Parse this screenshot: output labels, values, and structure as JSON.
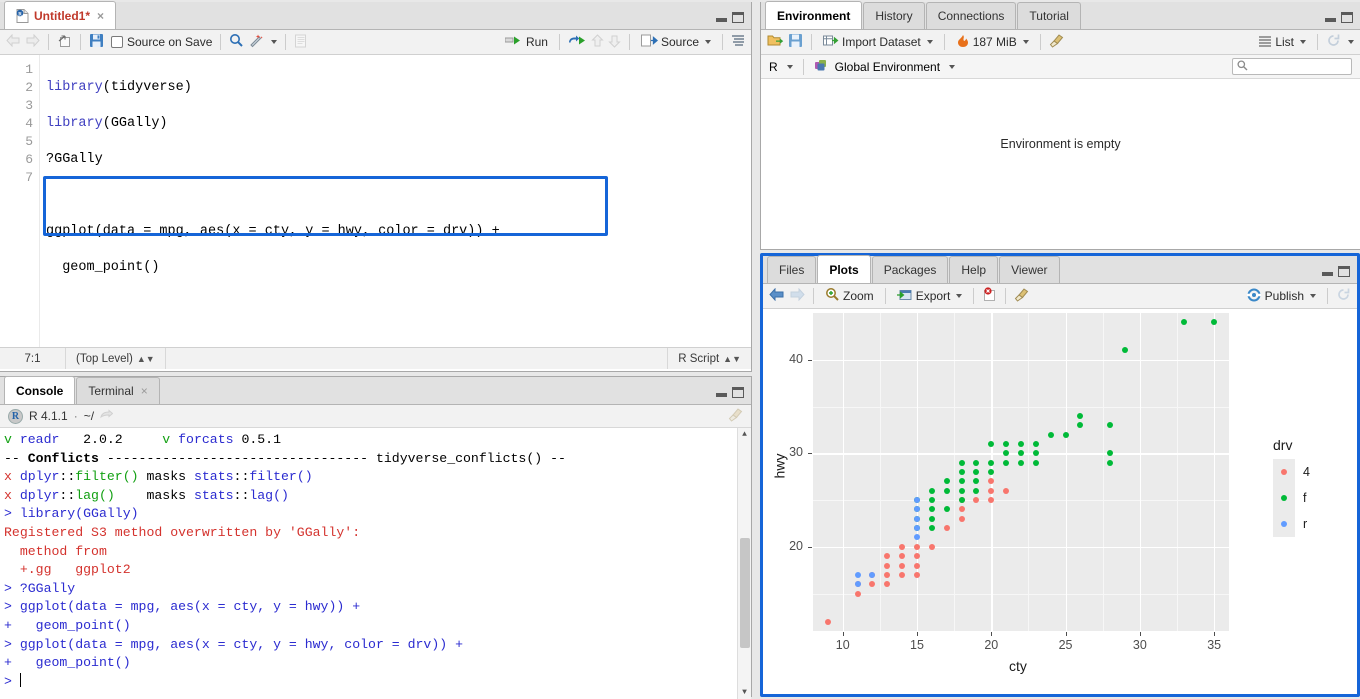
{
  "source": {
    "tab": {
      "label": "Untitled1*",
      "icon": "r-document-icon",
      "close": "×"
    },
    "toolbar": {
      "back": "back-arrow",
      "forward": "forward-arrow",
      "popout": "show-in-new-window",
      "save": "save-icon",
      "source_on_save_label": "Source on Save",
      "find": "magnifier-icon",
      "wand": "code-tools-icon",
      "outline_left": "compile-report-icon",
      "run_label": "Run",
      "rerun": "re-run-icon",
      "prev_chunk": "up-arrow",
      "next_chunk": "down-arrow",
      "source_label": "Source",
      "outline_label": "document-outline-icon"
    },
    "line_numbers": [
      "1",
      "2",
      "3",
      "4",
      "5",
      "6",
      "7"
    ],
    "code_lines": [
      {
        "kw": "library",
        "rest": "(tidyverse)"
      },
      {
        "kw": "library",
        "rest": "(GGally)"
      },
      {
        "kw": "",
        "rest": "?GGally"
      },
      {
        "kw": "",
        "rest": ""
      },
      {
        "kw": "",
        "rest": "ggplot(data = mpg, aes(x = cty, y = hwy, color = drv)) +"
      },
      {
        "kw": "",
        "rest": "  geom_point()"
      },
      {
        "kw": "",
        "rest": ""
      }
    ],
    "status": {
      "position": "7:1",
      "scope": "(Top Level)",
      "filetype": "R Script"
    }
  },
  "console": {
    "tabs": [
      {
        "label": "Console",
        "active": true,
        "closable": false
      },
      {
        "label": "Terminal",
        "active": false,
        "closable": true
      }
    ],
    "header": {
      "r_version": "R 4.1.1",
      "separator": "·",
      "path": "~/",
      "broom": "clear-console-icon"
    },
    "lines": [
      [
        {
          "t": "v ",
          "c": "green"
        },
        {
          "t": "readr   ",
          "c": "blue"
        },
        {
          "t": "2.0.2",
          "c": "black"
        },
        {
          "t": "     ",
          "c": "black"
        },
        {
          "t": "v ",
          "c": "green"
        },
        {
          "t": "forcats ",
          "c": "blue"
        },
        {
          "t": "0.5.1",
          "c": "black"
        }
      ],
      [
        {
          "t": "-- ",
          "c": "black"
        },
        {
          "t": "Conflicts",
          "c": "black",
          "b": true
        },
        {
          "t": " --------------------------------- tidyverse_conflicts() --",
          "c": "black"
        }
      ],
      [
        {
          "t": "x ",
          "c": "red"
        },
        {
          "t": "dplyr",
          "c": "blue"
        },
        {
          "t": "::",
          "c": "black"
        },
        {
          "t": "filter()",
          "c": "green"
        },
        {
          "t": " masks ",
          "c": "black"
        },
        {
          "t": "stats",
          "c": "blue"
        },
        {
          "t": "::",
          "c": "black"
        },
        {
          "t": "filter()",
          "c": "blue"
        }
      ],
      [
        {
          "t": "x ",
          "c": "red"
        },
        {
          "t": "dplyr",
          "c": "blue"
        },
        {
          "t": "::",
          "c": "black"
        },
        {
          "t": "lag()",
          "c": "green"
        },
        {
          "t": "    masks ",
          "c": "black"
        },
        {
          "t": "stats",
          "c": "blue"
        },
        {
          "t": "::",
          "c": "black"
        },
        {
          "t": "lag()",
          "c": "blue"
        }
      ],
      [
        {
          "t": "> ",
          "c": "blue"
        },
        {
          "t": "library(GGally)",
          "c": "blue"
        }
      ],
      [
        {
          "t": "Registered S3 method overwritten by 'GGally':",
          "c": "red"
        }
      ],
      [
        {
          "t": "  method from  ",
          "c": "red"
        }
      ],
      [
        {
          "t": "  +.gg   ggplot2",
          "c": "red"
        }
      ],
      [
        {
          "t": "> ",
          "c": "blue"
        },
        {
          "t": "?GGally",
          "c": "blue"
        }
      ],
      [
        {
          "t": "> ",
          "c": "blue"
        },
        {
          "t": "ggplot(data = mpg, aes(x = cty, y = hwy)) +",
          "c": "blue"
        }
      ],
      [
        {
          "t": "+ ",
          "c": "blue"
        },
        {
          "t": "  geom_point()",
          "c": "blue"
        }
      ],
      [
        {
          "t": "> ",
          "c": "blue"
        },
        {
          "t": "ggplot(data = mpg, aes(x = cty, y = hwy, color = drv)) +",
          "c": "blue"
        }
      ],
      [
        {
          "t": "+ ",
          "c": "blue"
        },
        {
          "t": "  geom_point()",
          "c": "blue"
        }
      ],
      [
        {
          "t": "> ",
          "c": "blue"
        }
      ]
    ]
  },
  "environment": {
    "tabs": [
      {
        "label": "Environment",
        "active": true
      },
      {
        "label": "History",
        "active": false
      },
      {
        "label": "Connections",
        "active": false
      },
      {
        "label": "Tutorial",
        "active": false
      }
    ],
    "toolbar": {
      "load": "open-folder-icon",
      "save": "save-icon",
      "import_label": "Import Dataset",
      "memory_label": "187 MiB",
      "memory_icon": "memory-usage-icon",
      "broom": "clear-objects-icon",
      "view_label": "List",
      "refresh": "refresh-icon"
    },
    "scope": {
      "language": "R",
      "name": "Global Environment",
      "package_icon": "cubes-icon"
    },
    "search_placeholder": "",
    "empty_message": "Environment is empty"
  },
  "plots": {
    "tabs": [
      {
        "label": "Files",
        "active": false
      },
      {
        "label": "Plots",
        "active": true
      },
      {
        "label": "Packages",
        "active": false
      },
      {
        "label": "Help",
        "active": false
      },
      {
        "label": "Viewer",
        "active": false
      }
    ],
    "toolbar": {
      "back": "back-arrow",
      "forward": "forward-arrow",
      "zoom_label": "Zoom",
      "zoom_icon": "magnifier-plus-icon",
      "export_label": "Export",
      "export_icon": "export-icon",
      "remove_icon": "remove-plot-icon",
      "clear_icon": "clear-all-plots-icon",
      "publish_label": "Publish",
      "publish_icon": "publish-icon",
      "refresh_icon": "refresh-icon"
    }
  },
  "chart_data": {
    "type": "scatter",
    "title": "",
    "xlabel": "cty",
    "ylabel": "hwy",
    "xlim": [
      8,
      36
    ],
    "ylim": [
      11,
      45
    ],
    "xticks": [
      10,
      15,
      20,
      25,
      30,
      35
    ],
    "yticks": [
      20,
      30,
      40
    ],
    "grid": true,
    "panel_bg": "#ebebeb",
    "grid_major_color": "#ffffff",
    "legend": {
      "title": "drv",
      "position": "right",
      "entries": [
        {
          "label": "4",
          "color": "#F8766D"
        },
        {
          "label": "f",
          "color": "#00BA38"
        },
        {
          "label": "r",
          "color": "#619CFF"
        }
      ]
    },
    "series": [
      {
        "name": "4",
        "color": "#F8766D",
        "points": [
          [
            9,
            12
          ],
          [
            11,
            15
          ],
          [
            11,
            16
          ],
          [
            12,
            17
          ],
          [
            12,
            16
          ],
          [
            13,
            17
          ],
          [
            13,
            18
          ],
          [
            13,
            19
          ],
          [
            13,
            16
          ],
          [
            14,
            17
          ],
          [
            14,
            18
          ],
          [
            14,
            19
          ],
          [
            14,
            20
          ],
          [
            15,
            17
          ],
          [
            15,
            18
          ],
          [
            15,
            19
          ],
          [
            15,
            20
          ],
          [
            16,
            20
          ],
          [
            17,
            22
          ],
          [
            18,
            23
          ],
          [
            18,
            24
          ],
          [
            18,
            25
          ],
          [
            19,
            25
          ],
          [
            20,
            25
          ],
          [
            20,
            26
          ],
          [
            20,
            27
          ],
          [
            21,
            26
          ]
        ]
      },
      {
        "name": "f",
        "color": "#00BA38",
        "points": [
          [
            15,
            22
          ],
          [
            15,
            23
          ],
          [
            15,
            24
          ],
          [
            15,
            25
          ],
          [
            16,
            22
          ],
          [
            16,
            23
          ],
          [
            16,
            24
          ],
          [
            16,
            25
          ],
          [
            16,
            26
          ],
          [
            17,
            24
          ],
          [
            17,
            26
          ],
          [
            17,
            27
          ],
          [
            18,
            25
          ],
          [
            18,
            26
          ],
          [
            18,
            27
          ],
          [
            18,
            28
          ],
          [
            18,
            29
          ],
          [
            19,
            26
          ],
          [
            19,
            27
          ],
          [
            19,
            28
          ],
          [
            19,
            29
          ],
          [
            20,
            28
          ],
          [
            20,
            29
          ],
          [
            20,
            31
          ],
          [
            21,
            29
          ],
          [
            21,
            30
          ],
          [
            21,
            31
          ],
          [
            22,
            29
          ],
          [
            22,
            30
          ],
          [
            22,
            31
          ],
          [
            23,
            29
          ],
          [
            23,
            30
          ],
          [
            23,
            31
          ],
          [
            24,
            32
          ],
          [
            25,
            32
          ],
          [
            26,
            33
          ],
          [
            26,
            34
          ],
          [
            28,
            29
          ],
          [
            28,
            30
          ],
          [
            28,
            33
          ],
          [
            29,
            41
          ],
          [
            33,
            44
          ],
          [
            35,
            44
          ]
        ]
      },
      {
        "name": "r",
        "color": "#619CFF",
        "points": [
          [
            11,
            17
          ],
          [
            11,
            16
          ],
          [
            12,
            17
          ],
          [
            15,
            21
          ],
          [
            15,
            22
          ],
          [
            15,
            23
          ],
          [
            15,
            24
          ],
          [
            15,
            25
          ]
        ]
      }
    ]
  }
}
